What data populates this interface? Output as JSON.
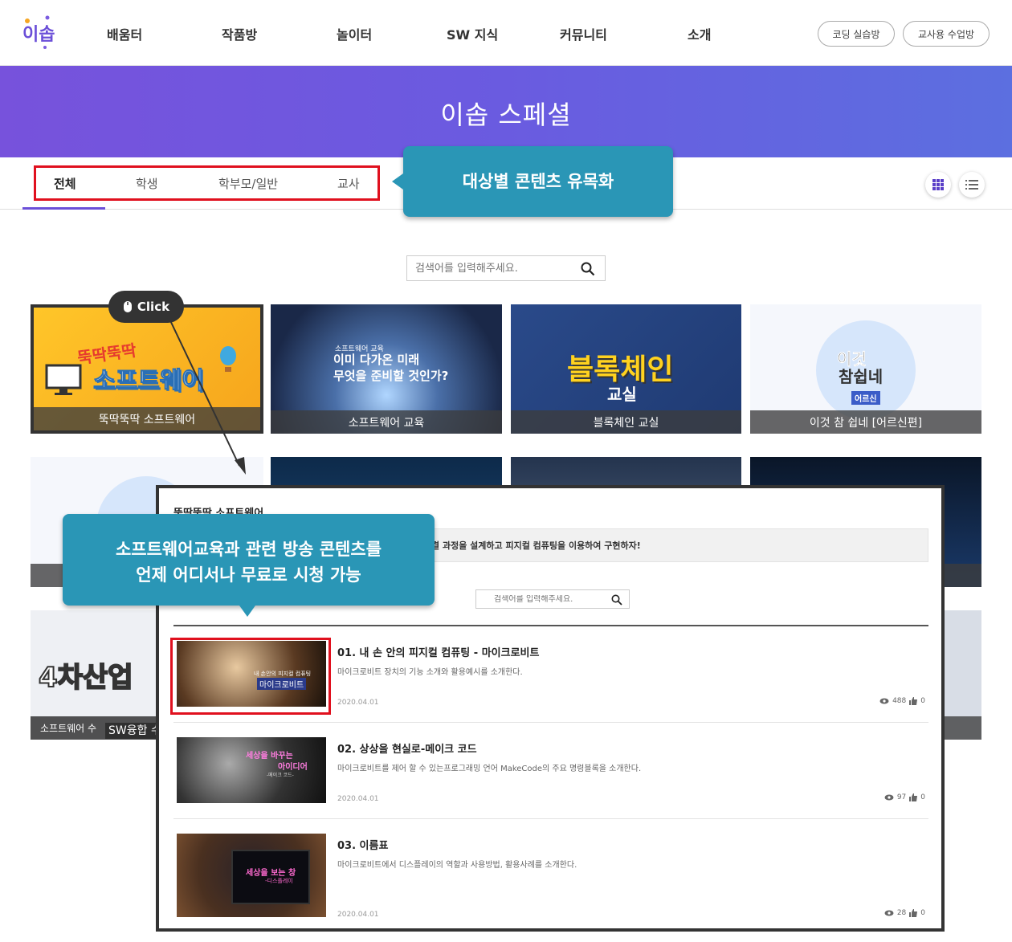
{
  "header": {
    "logo_text": "이솝",
    "nav": [
      "배움터",
      "작품방",
      "놀이터",
      "SW 지식",
      "커뮤니티",
      "소개"
    ],
    "buttons": [
      "코딩 실습방",
      "교사용 수업방"
    ]
  },
  "banner": {
    "title": "이솝 스페셜"
  },
  "tabs": [
    "전체",
    "학생",
    "학부모/일반",
    "교사"
  ],
  "callouts": {
    "top": "대상별 콘텐츠 유목화",
    "bottom_line1": "소프트웨어교육과 관련 방송 콘텐츠를",
    "bottom_line2": "언제 어디서나 무료로 시청 가능"
  },
  "search": {
    "placeholder": "검색어를 입력해주세요."
  },
  "click_badge": "Click",
  "cards_row1": [
    {
      "caption": "뚝딱뚝딱 소프트웨어",
      "art1": "뚝딱뚝딱",
      "art2": "소프트웨어"
    },
    {
      "caption": "소프트웨어 교육",
      "art0": "소프트웨어 교육",
      "art1": "이미 다가온 미래",
      "art2": "무엇을 준비할 것인가?"
    },
    {
      "caption": "블록체인 교실",
      "art1": "블록체인",
      "art2": "교실"
    },
    {
      "caption": "이것 참 쉽네 [어르신편]",
      "art1": "이것",
      "art2": "참쉽네",
      "art3": "어르신"
    }
  ],
  "cards_row3": [
    {
      "caption": "소프트웨어 수",
      "art1": "4차산업"
    },
    {
      "caption": "SW융합 수"
    }
  ],
  "popup": {
    "title": "뚝딱뚝딱 소프트웨어",
    "desc": "결 과정을 설계하고 피지컬 컴퓨팅을 이용하여 구현하자!",
    "search_placeholder": "검색어를 입력해주세요.",
    "videos": [
      {
        "title": "01. 내 손 안의 피지컬 컴퓨팅 - 마이크로비트",
        "desc": "마이크로비트 장치의 기능 소개와 활용예시를 소개한다.",
        "date": "2020.04.01",
        "views": "488",
        "likes": "0",
        "thumb_small": "내 손안의 피지컬 컴퓨팅",
        "thumb_big": "마이크로비트"
      },
      {
        "title": "02. 상상을 현실로-메이크 코드",
        "desc": "마이크로비트를 제어 할 수 있는프로그래밍 언어 MakeCode의 주요 명령블록을 소개한다.",
        "date": "2020.04.01",
        "views": "97",
        "likes": "0",
        "thumb_l1": "세상을 바꾸는",
        "thumb_l2": "아이디어",
        "thumb_l3": "-메이크 코드-"
      },
      {
        "title": "03. 이름표",
        "desc": "마이크로비트에서 디스플레이의 역할과 사용방법, 활용사례를 소개한다.",
        "date": "2020.04.01",
        "views": "28",
        "likes": "0",
        "thumb_l1": "세상을 보는 창",
        "thumb_l2": "-디스플레이"
      }
    ]
  },
  "colors": {
    "accent": "#6b4fd8",
    "callout": "#2a96b6",
    "highlight": "#e0101e"
  }
}
